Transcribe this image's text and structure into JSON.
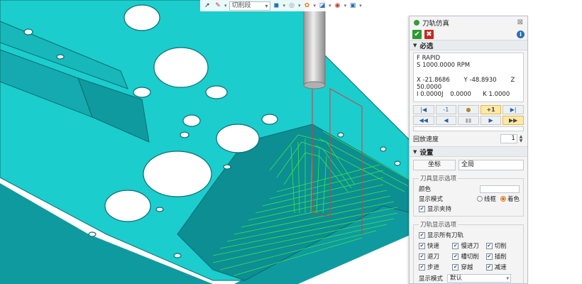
{
  "toolbar": {
    "mode_select": "切削段",
    "icons": [
      "arrow-icon",
      "brush-icon",
      "square-icon",
      "circle-icon",
      "settings-icon",
      "view-icon",
      "sphere-icon",
      "save-icon"
    ]
  },
  "panel": {
    "title": "刀轨仿真",
    "required_section": "必选",
    "info": {
      "line1": "F  RAPID",
      "line2": "S 1000.0000 RPM",
      "x_label": "X",
      "x_value": "-21.8686",
      "y_label": "Y",
      "y_value": "-48.8930",
      "z_label": "Z",
      "z_value": "50.0000",
      "i_label": "I",
      "i_value": "0.0000J",
      "j_value": "0.0000",
      "k_label": "K",
      "k_value": "1.0000"
    },
    "controls_row1": [
      "|◀",
      "-1",
      "●",
      "+1",
      "▶|"
    ],
    "controls_row2": [
      "◀◀",
      "◀",
      "▮▮",
      "▶",
      "▶▶"
    ],
    "speed_label": "回放速度",
    "speed_value": "1",
    "settings_section": "设置",
    "coord_label": "坐标",
    "coord_value": "全局",
    "tool_group": {
      "legend": "刀具显示选项",
      "color_label": "颜色",
      "display_mode_label": "显示模式",
      "radio_wire": "线框",
      "radio_shade": "着色",
      "show_holder": "显示夹持"
    },
    "path_group": {
      "legend": "刀轨显示选项",
      "show_all": "显示所有刀轨",
      "items": [
        "快速",
        "慢进刀",
        "切削",
        "退刀",
        "槽切削",
        "插削",
        "步进",
        "穿越",
        "减速"
      ],
      "mode_label": "显示模式",
      "mode_value": "默认"
    }
  },
  "colors": {
    "part": "#19c9c9",
    "part_dark": "#0c8e93",
    "toolpath": "#37e84a",
    "accent": "#e07a1a"
  }
}
